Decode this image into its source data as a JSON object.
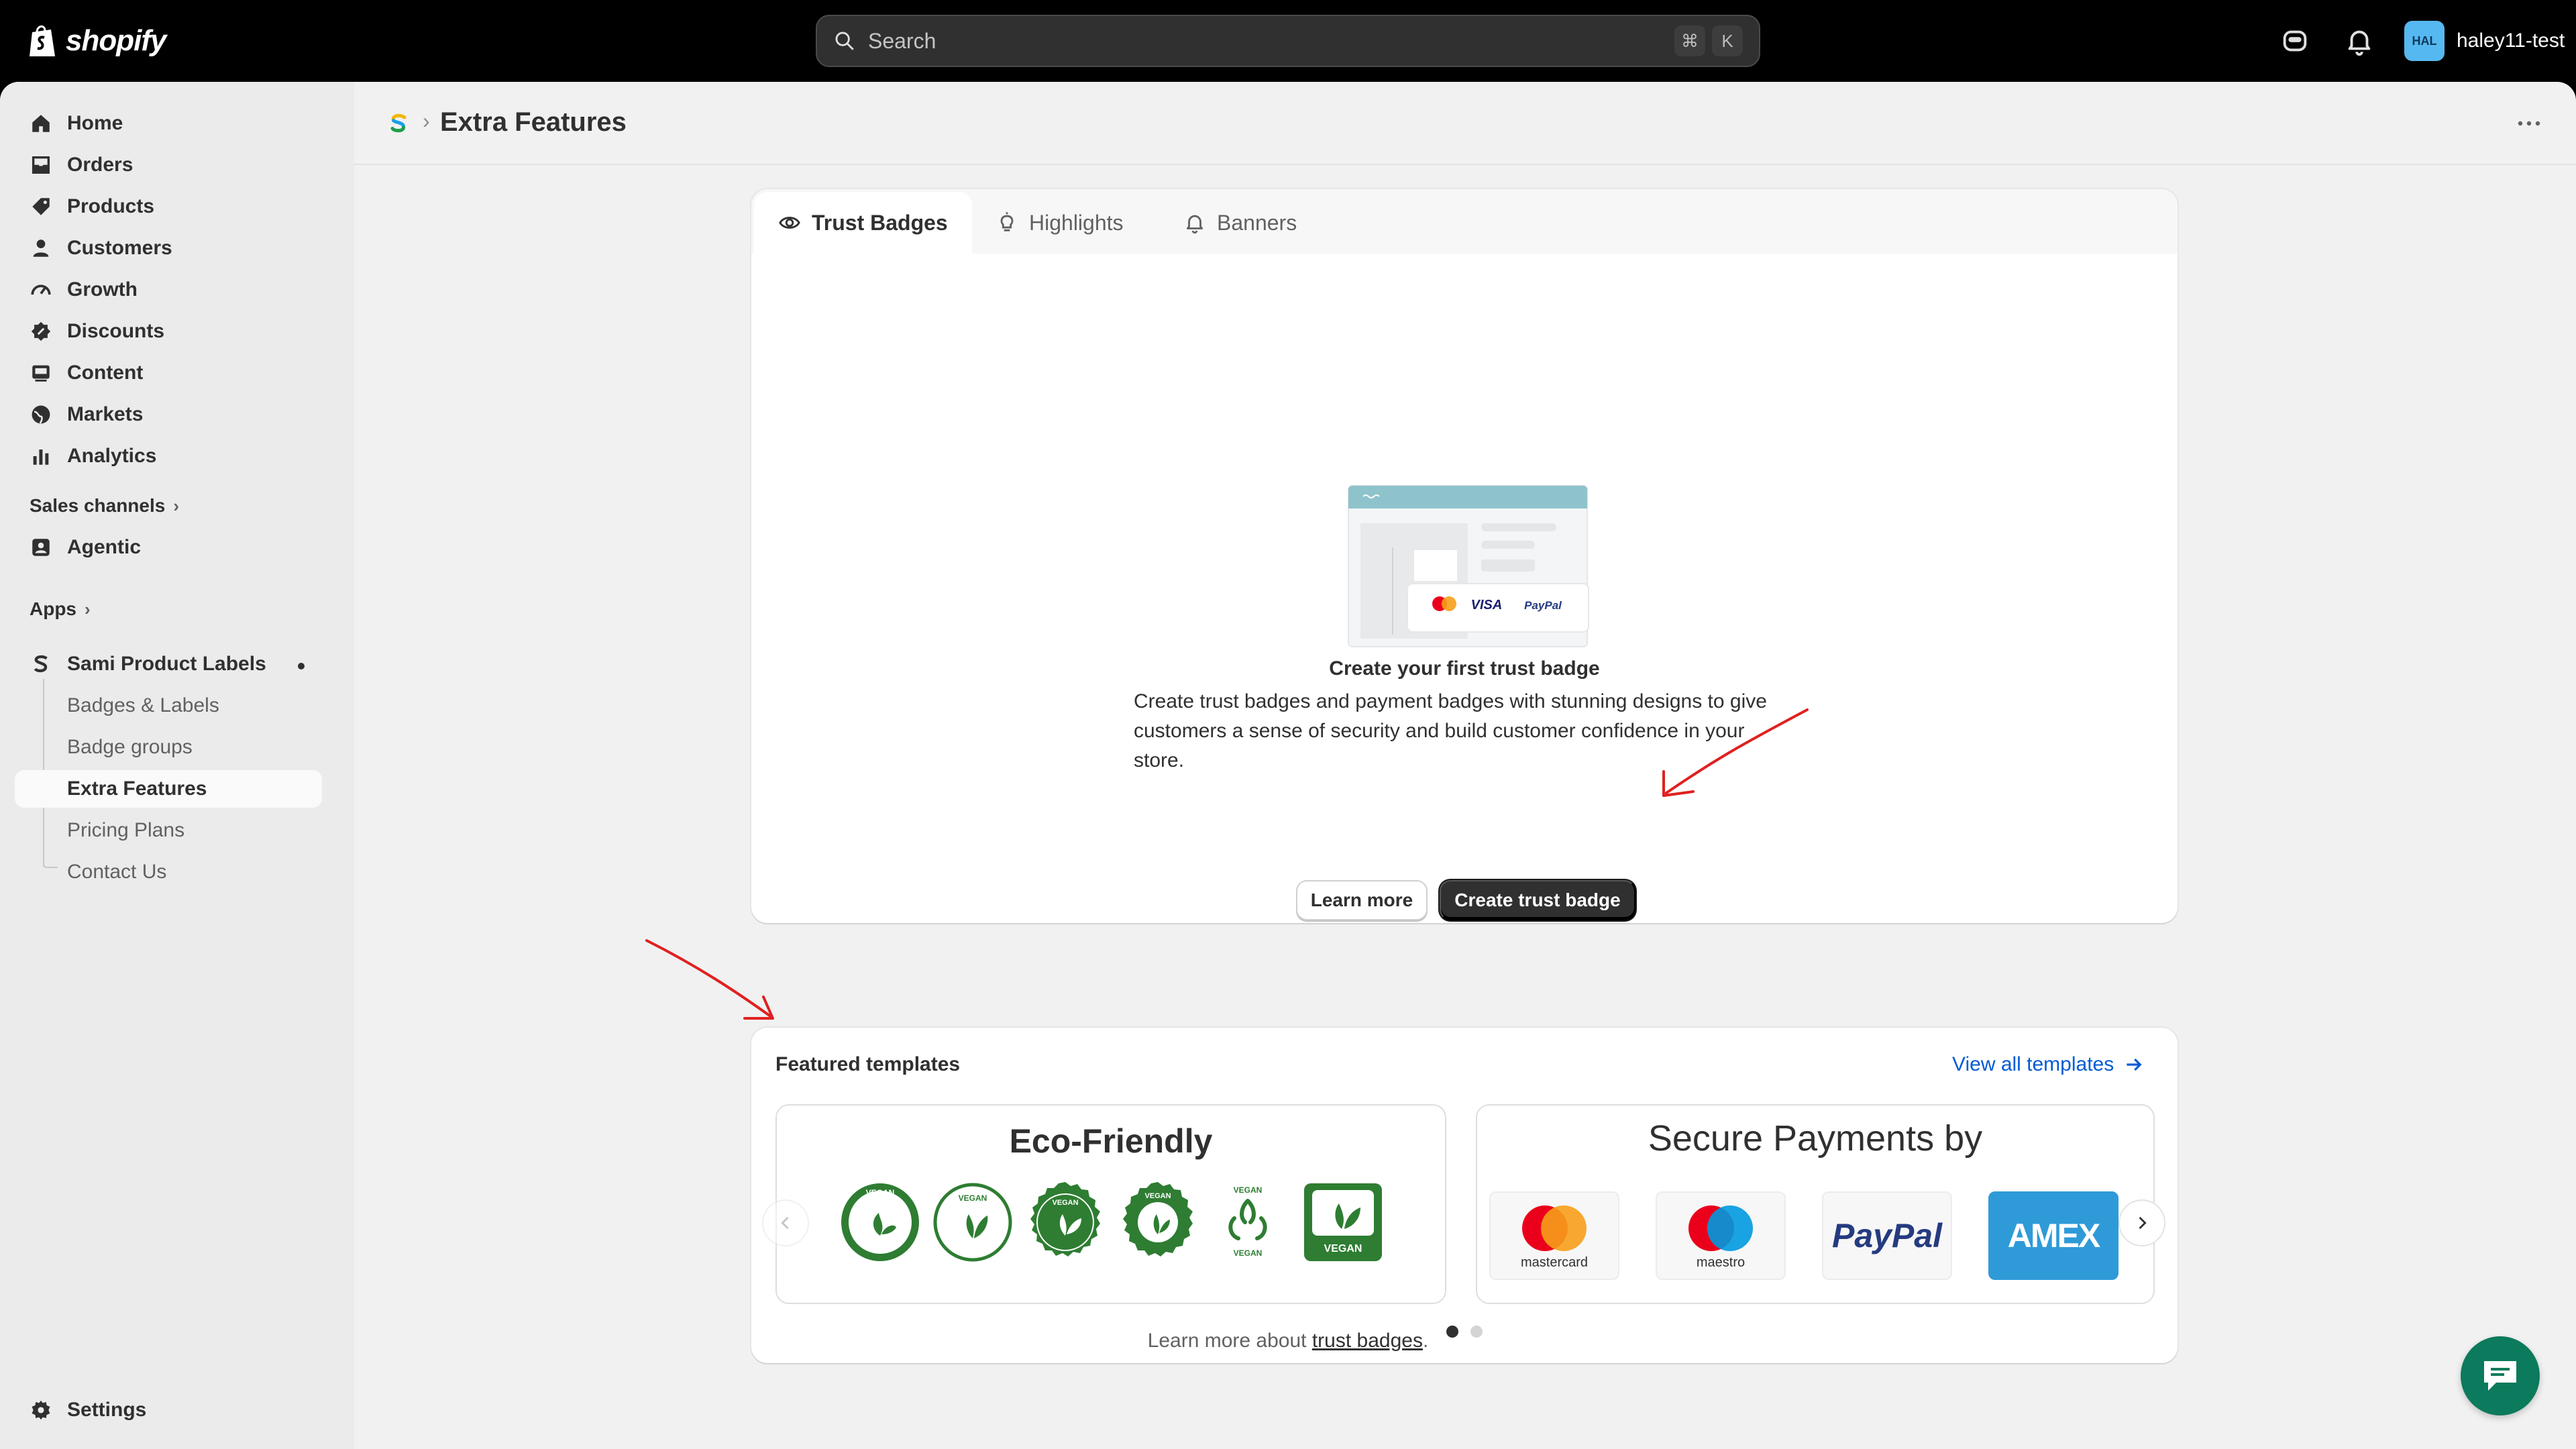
{
  "topbar": {
    "brand": "shopify",
    "search_placeholder": "Search",
    "shortcut_keys": [
      "⌘",
      "K"
    ],
    "user_initials": "HAL",
    "user_name": "haley11-test"
  },
  "sidebar": {
    "items": [
      {
        "label": "Home",
        "icon": "home-icon"
      },
      {
        "label": "Orders",
        "icon": "inbox-icon"
      },
      {
        "label": "Products",
        "icon": "tag-icon"
      },
      {
        "label": "Customers",
        "icon": "person-icon"
      },
      {
        "label": "Growth",
        "icon": "gauge-icon"
      },
      {
        "label": "Discounts",
        "icon": "discount-icon"
      },
      {
        "label": "Content",
        "icon": "image-icon"
      },
      {
        "label": "Markets",
        "icon": "globe-icon"
      },
      {
        "label": "Analytics",
        "icon": "bar-chart-icon"
      }
    ],
    "sales_channels_label": "Sales channels",
    "agentic_label": "Agentic",
    "apps_label": "Apps",
    "app_name": "Sami Product Labels",
    "app_subitems": [
      "Badges & Labels",
      "Badge groups",
      "Extra Features",
      "Pricing Plans",
      "Contact Us"
    ],
    "settings_label": "Settings"
  },
  "page": {
    "title": "Extra Features"
  },
  "tabs": [
    "Trust Badges",
    "Highlights",
    "Banners"
  ],
  "empty_state": {
    "illustration_brands": [
      "VISA",
      "PayPal"
    ],
    "title": "Create your first trust badge",
    "description": "Create trust badges and payment badges with stunning designs to give customers a sense of security and build customer confidence in your store.",
    "learn_more_label": "Learn more",
    "create_label": "Create trust badge"
  },
  "featured": {
    "title": "Featured templates",
    "view_all_label": "View all templates",
    "templates": [
      {
        "title": "Eco-Friendly",
        "badge_text": "VEGAN"
      },
      {
        "title": "Secure Payments by",
        "payments": [
          "mastercard",
          "maestro",
          "PayPal",
          "AMEX"
        ]
      }
    ],
    "page_count": 2,
    "current_page": 1
  },
  "footer": {
    "prefix": "Learn more about ",
    "link": "trust badges",
    "suffix": "."
  },
  "colors": {
    "brand_green": "#0c7a5c",
    "link_blue": "#005bd3",
    "vegan_green": "#2e7d32",
    "annotation_red": "#e02020"
  }
}
